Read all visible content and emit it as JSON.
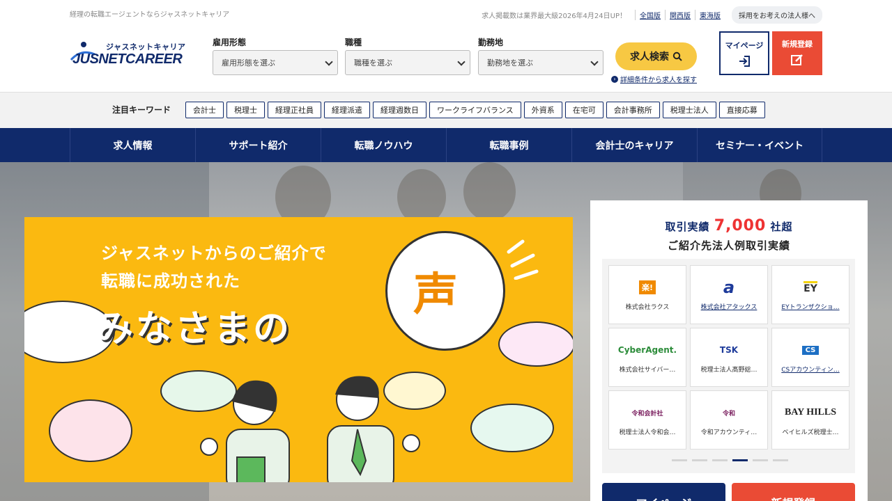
{
  "topbar": {
    "tagline": "経理の転職エージェントならジャスネットキャリア",
    "notice": "求人掲載数は業界最大級2026年4月24日UP！",
    "regions": [
      "全国版",
      "関西版",
      "東海版"
    ],
    "corporate_link": "採用をお考えの法人様へ"
  },
  "logo": {
    "kana": "ジャスネットキャリア",
    "english": "JUSNETCAREER"
  },
  "search": {
    "employment": {
      "label": "雇用形態",
      "value": "雇用形態を選ぶ"
    },
    "jobtype": {
      "label": "職種",
      "value": "職種を選ぶ"
    },
    "location": {
      "label": "勤務地",
      "value": "勤務地を選ぶ"
    },
    "button": "求人検索",
    "detail_link": "詳細条件から求人を探す"
  },
  "account": {
    "mypage": "マイページ",
    "register": "新規登録"
  },
  "keywords": {
    "label": "注目キーワード",
    "items": [
      "会計士",
      "税理士",
      "経理正社員",
      "経理派遣",
      "経理週数日",
      "ワークライフバランス",
      "外資系",
      "在宅可",
      "会計事務所",
      "税理士法人",
      "直接応募"
    ]
  },
  "nav": [
    "求人情報",
    "サポート紹介",
    "転職ノウハウ",
    "転職事例",
    "会計士のキャリア",
    "セミナー・イベント"
  ],
  "banner": {
    "line1": "ジャスネットからのご紹介で",
    "line2": "転職に成功された",
    "big": "みなさまの",
    "voice": "声"
  },
  "panel": {
    "title_prefix": "取引実績",
    "title_number": "7,000",
    "title_suffix": "社超",
    "subtitle": "ご紹介先法人例取引実績",
    "companies": [
      {
        "logo": "楽!",
        "name": "株式会社ラクス",
        "link": false
      },
      {
        "logo": "a",
        "name": "株式会社アタックス",
        "link": true
      },
      {
        "logo": "EY",
        "name": "EYトランザクショ…",
        "link": true
      },
      {
        "logo": "CyberAgent.",
        "name": "株式会社サイバー…",
        "link": false
      },
      {
        "logo": "TSK",
        "name": "税理士法人髙野総…",
        "link": false
      },
      {
        "logo": "CS",
        "name": "CSアカウンティン…",
        "link": true
      },
      {
        "logo": "令和会計社",
        "name": "税理士法人令和会…",
        "link": false
      },
      {
        "logo": "令和",
        "name": "令和アカウンティ…",
        "link": false
      },
      {
        "logo": "BAY HILLS",
        "name": "ベイヒルズ税理士…",
        "link": false
      }
    ],
    "slide_index": 4,
    "slide_count": 6,
    "button_mypage": "マイページ",
    "button_register": "新規登録"
  }
}
